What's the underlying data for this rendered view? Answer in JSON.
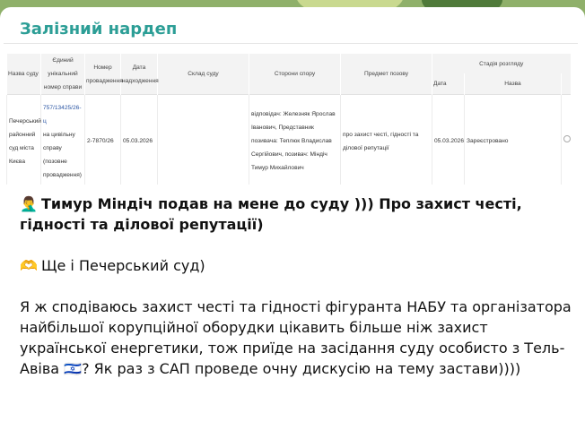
{
  "channel": {
    "name": "Залізний нардеп"
  },
  "court_table": {
    "headers": {
      "court_name": "Назва суду",
      "unique_number": "Єдиний унікальний номер справи",
      "proceeding_number": "Номер провадження",
      "receipt_date": "Дата надходження",
      "composition": "Склад суду",
      "parties": "Сторони спору",
      "subject": "Предмет позову",
      "stage": "Стадія розгляду",
      "stage_date": "Дата",
      "stage_name": "Назва"
    },
    "row": {
      "court_name": "Печерський районний суд міста Києва",
      "case_number": "757/13425/26-ц",
      "case_note": "на цивільну справу (позовне провадження)",
      "proceeding_number": "2-7870/26",
      "receipt_date": "05.03.2026",
      "composition": "",
      "parties": "відповідач: Железняк Ярослав Іванович, Представник позивача: Теплюк Владислав Сергійович, позивач: Міндіч Тимур Михайлович",
      "subject": "про захист честі, гідності та ділової репутації",
      "stage_date": "05.03.2026",
      "stage_name": "Зареєстровано"
    }
  },
  "message": {
    "line1_emoji": "🤦‍♂️",
    "line1": "Тимур Міндіч подав на мене до суду ))) Про захист честі, гідності та ділової репутації)",
    "line2_emoji": "🫶",
    "line2": "Ще і Печерський суд)",
    "line3": "Я ж сподіваюсь захист честі та гідності фігуранта НАБУ та організатора найбільшої корупційної оборудки цікавить більше ніж захист української енергетики, тож приїде на засідання суду особисто з Тель-Авіва 🇮🇱? Як раз з САП проведе очну дискусію на тему застави))))"
  },
  "colors": {
    "sender": "#2c9e96",
    "link": "#2a55a3",
    "wallpaper": "#8fb06a"
  }
}
